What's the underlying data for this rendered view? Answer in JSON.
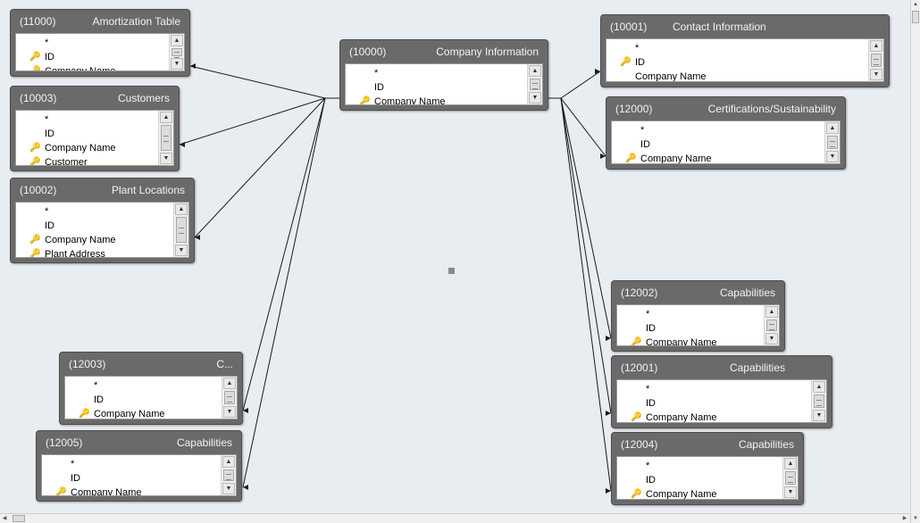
{
  "tables": [
    {
      "id_label": "(11000)",
      "title": "Amortization Table",
      "fields": [
        {
          "name": "*",
          "key": false
        },
        {
          "name": "ID",
          "key": true
        },
        {
          "name": "Company Name",
          "key": true
        }
      ]
    },
    {
      "id_label": "(10003)",
      "title": "Customers",
      "fields": [
        {
          "name": "*",
          "key": false
        },
        {
          "name": "ID",
          "key": false
        },
        {
          "name": "Company Name",
          "key": true
        },
        {
          "name": "Customer",
          "key": true
        }
      ]
    },
    {
      "id_label": "(10002)",
      "title": "Plant Locations",
      "fields": [
        {
          "name": "*",
          "key": false
        },
        {
          "name": "ID",
          "key": false
        },
        {
          "name": "Company Name",
          "key": true
        },
        {
          "name": "Plant Address",
          "key": true
        }
      ]
    },
    {
      "id_label": "(12003)",
      "title": "C...",
      "fields": [
        {
          "name": "*",
          "key": false
        },
        {
          "name": "ID",
          "key": false
        },
        {
          "name": "Company Name",
          "key": true
        }
      ]
    },
    {
      "id_label": "(12005)",
      "title": "Capabilities",
      "fields": [
        {
          "name": "*",
          "key": false
        },
        {
          "name": "ID",
          "key": false
        },
        {
          "name": "Company Name",
          "key": true
        }
      ]
    },
    {
      "id_label": "(10000)",
      "title": "Company Information",
      "fields": [
        {
          "name": "*",
          "key": false
        },
        {
          "name": "ID",
          "key": false
        },
        {
          "name": "Company Name",
          "key": true
        }
      ]
    },
    {
      "id_label": "(10001)",
      "title": "Contact Information",
      "fields": [
        {
          "name": "*",
          "key": false
        },
        {
          "name": "ID",
          "key": true
        },
        {
          "name": "Company Name",
          "key": false
        }
      ]
    },
    {
      "id_label": "(12000)",
      "title": "Certifications/Sustainability",
      "fields": [
        {
          "name": "*",
          "key": false
        },
        {
          "name": "ID",
          "key": false
        },
        {
          "name": "Company Name",
          "key": true
        }
      ]
    },
    {
      "id_label": "(12002)",
      "title": "Capabilities",
      "fields": [
        {
          "name": "*",
          "key": false
        },
        {
          "name": "ID",
          "key": false
        },
        {
          "name": "Company Name",
          "key": true
        }
      ]
    },
    {
      "id_label": "(12001)",
      "title": "Capabilities",
      "fields": [
        {
          "name": "*",
          "key": false
        },
        {
          "name": "ID",
          "key": false
        },
        {
          "name": "Company Name",
          "key": true
        }
      ]
    },
    {
      "id_label": "(12004)",
      "title": "Capabilities",
      "fields": [
        {
          "name": "*",
          "key": false
        },
        {
          "name": "ID",
          "key": false
        },
        {
          "name": "Company Name",
          "key": true
        }
      ]
    }
  ],
  "icons": {
    "key": "key-icon",
    "scroll_up": "scroll-up-arrow-icon",
    "scroll_down": "scroll-down-arrow-icon",
    "center_handle": "selection-handle-icon"
  },
  "colors": {
    "canvas": "#e8edf2",
    "table_header": "#6a6a6a",
    "relation_line": "#1a1a1a",
    "key_icon": "#c89a1b"
  }
}
